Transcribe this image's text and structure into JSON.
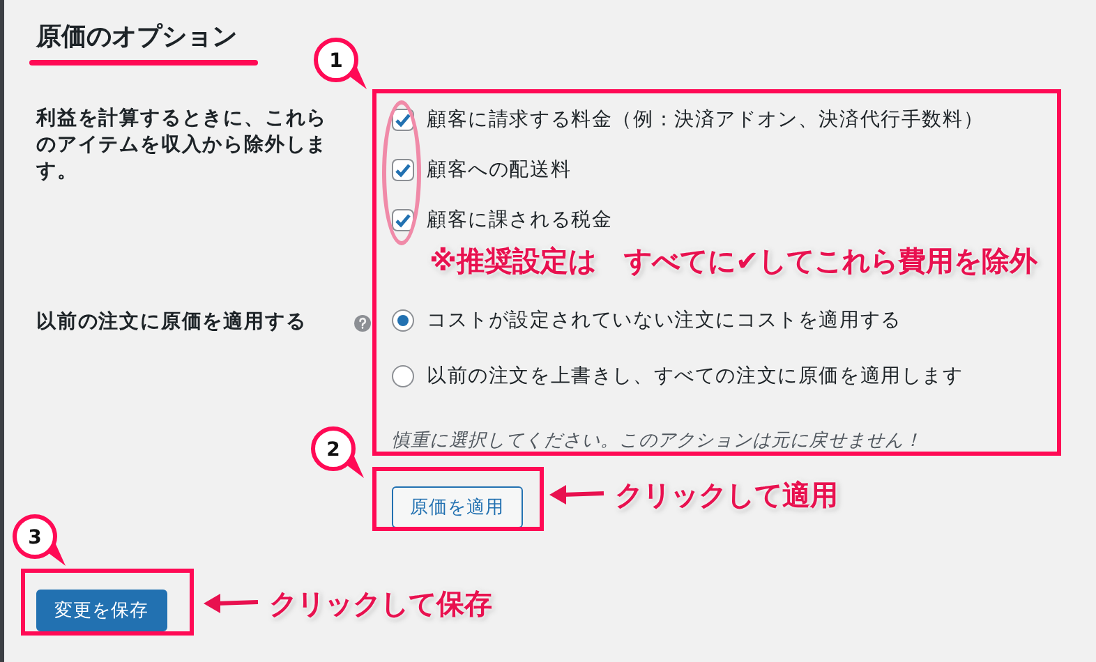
{
  "section": {
    "title": "原価のオプション"
  },
  "fields": [
    {
      "kind": "checkboxes",
      "label": "利益を計算するときに、これらのアイテムを収入から除外します。",
      "options": [
        {
          "label": "顧客に請求する料金（例：決済アドオン、決済代行手数料）",
          "checked": true
        },
        {
          "label": "顧客への配送料",
          "checked": true
        },
        {
          "label": "顧客に課される税金",
          "checked": true
        }
      ]
    },
    {
      "kind": "radios",
      "label": "以前の注文に原価を適用する",
      "options": [
        {
          "label": "コストが設定されていない注文にコストを適用する",
          "selected": true
        },
        {
          "label": "以前の注文を上書きし、すべての注文に原価を適用します",
          "selected": false
        }
      ],
      "note": "慎重に選択してください。このアクションは元に戻せません！"
    }
  ],
  "apply_button": "原価を適用",
  "save_button": "変更を保存",
  "annotations": {
    "callouts": [
      "1",
      "2",
      "3"
    ],
    "recommendation": "※推奨設定は　すべてに✔してこれら費用を除外",
    "arrow_labels": [
      "クリックして適用",
      "クリックして保存"
    ]
  }
}
